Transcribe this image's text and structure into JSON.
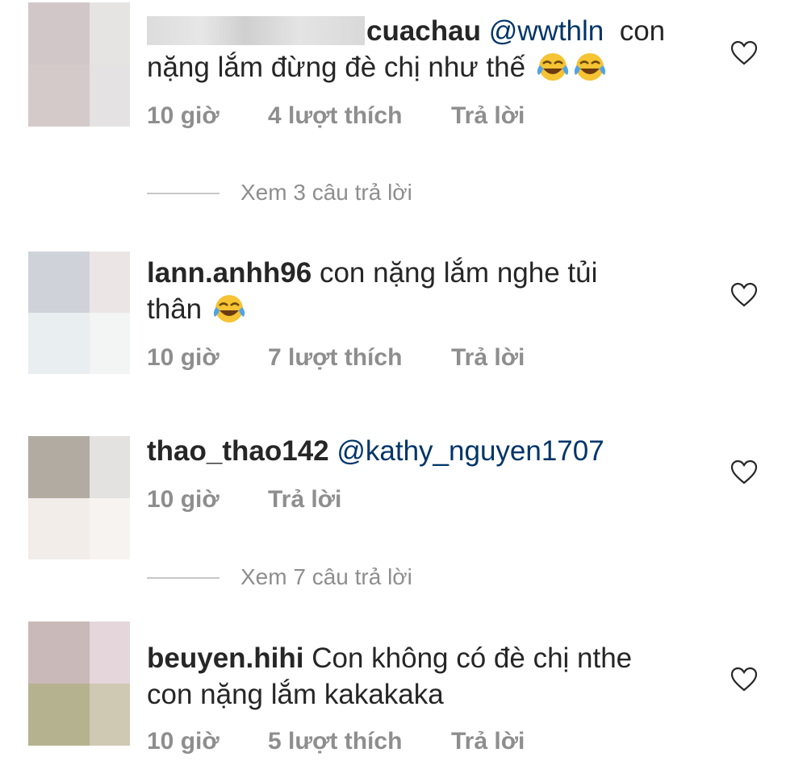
{
  "comments": [
    {
      "username": "cuachau",
      "mention": "@wwthln",
      "text_before": "con",
      "text_line2": "nặng lắm đừng đè chị như thế",
      "emojis": [
        "face-with-tears-of-joy-icon",
        "face-with-tears-of-joy-icon"
      ],
      "time": "10 giờ",
      "likes": "4 lượt thích",
      "reply": "Trả lời",
      "avatar_colors": [
        "#d2c7c8",
        "#e6e3e3",
        "#d4caca",
        "#e4e2e2"
      ]
    },
    {
      "username": "lann.anhh96",
      "text": "con nặng lắm nghe tủi",
      "text_line2": "thân",
      "emojis": [
        "face-with-tears-of-joy-icon"
      ],
      "time": "10 giờ",
      "likes": "7 lượt thích",
      "reply": "Trả lời",
      "avatar_colors": [
        "#cfd2d8",
        "#ebe5e6",
        "#e9eef0",
        "#f3f4f4"
      ]
    },
    {
      "username": "thao_thao142",
      "mention": "@kathy_nguyen1707",
      "time": "10 giờ",
      "reply": "Trả lời",
      "avatar_colors": [
        "#b2aba2",
        "#e3e2e0",
        "#f2ede9",
        "#f6f3f1"
      ]
    },
    {
      "username": "beuyen.hihi",
      "text": "Con không có đè chị nthe",
      "text_line2": "con nặng lắm kakakaka",
      "time": "10 giờ",
      "likes": "5 lượt thích",
      "reply": "Trả lời",
      "avatar_colors": [
        "#c9b9b8",
        "#e4d6da",
        "#b5b290",
        "#cfc8b3"
      ]
    }
  ],
  "view_replies": [
    {
      "label": "Xem 3 câu trả lời"
    },
    {
      "label": "Xem 7 câu trả lời"
    }
  ]
}
